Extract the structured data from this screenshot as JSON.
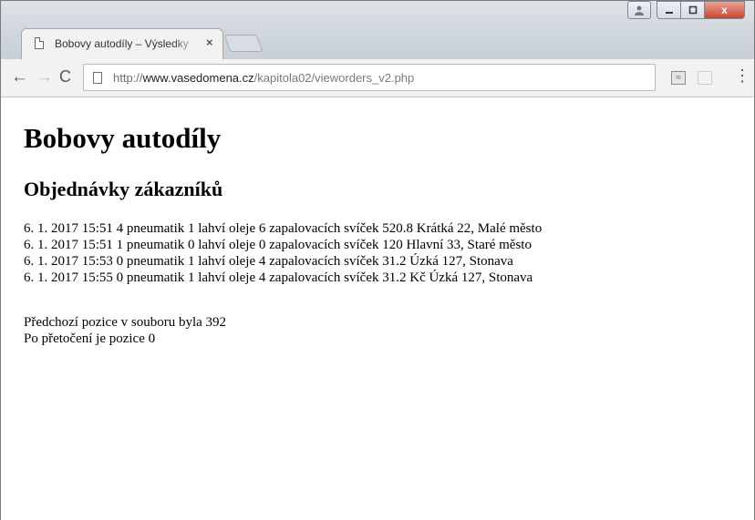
{
  "browser": {
    "tab_title": "Bobovy autodíly – Výsledky",
    "tab_close": "×",
    "url_protocol": "http://",
    "url_host": "www.vasedomena.cz",
    "url_path": "/kapitola02/vieworders_v2.php",
    "window_close": "x",
    "menu_dots": "⋮"
  },
  "page": {
    "heading": "Bobovy autodíly",
    "subheading": "Objednávky zákazníků",
    "orders": [
      "6. 1. 2017 15:51 4 pneumatik 1 lahví oleje 6 zapalovacích svíček 520.8 Krátká 22, Malé město",
      "6. 1. 2017 15:51 1 pneumatik 0 lahví oleje 0 zapalovacích svíček 120 Hlavní 33, Staré město",
      "6. 1. 2017 15:53 0 pneumatik 1 lahví oleje 4 zapalovacích svíček 31.2 Úzká 127, Stonava",
      "6. 1. 2017 15:55 0 pneumatik 1 lahví oleje 4 zapalovacích svíček 31.2 Kč Úzká 127, Stonava"
    ],
    "position_before": "Předchozí pozice v souboru byla 392",
    "position_after": "Po přetočení je pozice 0"
  }
}
